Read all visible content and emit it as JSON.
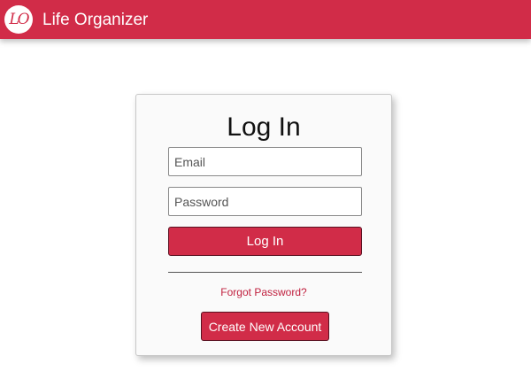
{
  "app_bar": {
    "logo_text": "LO",
    "logo_icon": "life-organizer-logo",
    "title": "Life Organizer"
  },
  "login_card": {
    "title": "Log In",
    "email": {
      "placeholder": "Email",
      "value": ""
    },
    "password": {
      "placeholder": "Password",
      "value": ""
    },
    "login_label": "Log In",
    "forgot_label": "Forgot Password?",
    "create_label": "Create New Account"
  },
  "colors": {
    "brand": "#d12c48",
    "link": "#c0203f",
    "card_background": "#fafafa"
  }
}
